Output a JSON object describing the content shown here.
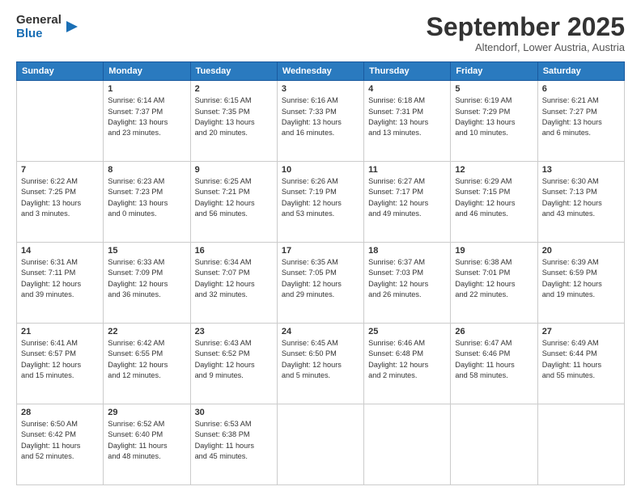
{
  "logo": {
    "line1": "General",
    "line2": "Blue"
  },
  "header": {
    "month": "September 2025",
    "location": "Altendorf, Lower Austria, Austria"
  },
  "days_of_week": [
    "Sunday",
    "Monday",
    "Tuesday",
    "Wednesday",
    "Thursday",
    "Friday",
    "Saturday"
  ],
  "weeks": [
    [
      {
        "day": "",
        "info": ""
      },
      {
        "day": "1",
        "info": "Sunrise: 6:14 AM\nSunset: 7:37 PM\nDaylight: 13 hours\nand 23 minutes."
      },
      {
        "day": "2",
        "info": "Sunrise: 6:15 AM\nSunset: 7:35 PM\nDaylight: 13 hours\nand 20 minutes."
      },
      {
        "day": "3",
        "info": "Sunrise: 6:16 AM\nSunset: 7:33 PM\nDaylight: 13 hours\nand 16 minutes."
      },
      {
        "day": "4",
        "info": "Sunrise: 6:18 AM\nSunset: 7:31 PM\nDaylight: 13 hours\nand 13 minutes."
      },
      {
        "day": "5",
        "info": "Sunrise: 6:19 AM\nSunset: 7:29 PM\nDaylight: 13 hours\nand 10 minutes."
      },
      {
        "day": "6",
        "info": "Sunrise: 6:21 AM\nSunset: 7:27 PM\nDaylight: 13 hours\nand 6 minutes."
      }
    ],
    [
      {
        "day": "7",
        "info": "Sunrise: 6:22 AM\nSunset: 7:25 PM\nDaylight: 13 hours\nand 3 minutes."
      },
      {
        "day": "8",
        "info": "Sunrise: 6:23 AM\nSunset: 7:23 PM\nDaylight: 13 hours\nand 0 minutes."
      },
      {
        "day": "9",
        "info": "Sunrise: 6:25 AM\nSunset: 7:21 PM\nDaylight: 12 hours\nand 56 minutes."
      },
      {
        "day": "10",
        "info": "Sunrise: 6:26 AM\nSunset: 7:19 PM\nDaylight: 12 hours\nand 53 minutes."
      },
      {
        "day": "11",
        "info": "Sunrise: 6:27 AM\nSunset: 7:17 PM\nDaylight: 12 hours\nand 49 minutes."
      },
      {
        "day": "12",
        "info": "Sunrise: 6:29 AM\nSunset: 7:15 PM\nDaylight: 12 hours\nand 46 minutes."
      },
      {
        "day": "13",
        "info": "Sunrise: 6:30 AM\nSunset: 7:13 PM\nDaylight: 12 hours\nand 43 minutes."
      }
    ],
    [
      {
        "day": "14",
        "info": "Sunrise: 6:31 AM\nSunset: 7:11 PM\nDaylight: 12 hours\nand 39 minutes."
      },
      {
        "day": "15",
        "info": "Sunrise: 6:33 AM\nSunset: 7:09 PM\nDaylight: 12 hours\nand 36 minutes."
      },
      {
        "day": "16",
        "info": "Sunrise: 6:34 AM\nSunset: 7:07 PM\nDaylight: 12 hours\nand 32 minutes."
      },
      {
        "day": "17",
        "info": "Sunrise: 6:35 AM\nSunset: 7:05 PM\nDaylight: 12 hours\nand 29 minutes."
      },
      {
        "day": "18",
        "info": "Sunrise: 6:37 AM\nSunset: 7:03 PM\nDaylight: 12 hours\nand 26 minutes."
      },
      {
        "day": "19",
        "info": "Sunrise: 6:38 AM\nSunset: 7:01 PM\nDaylight: 12 hours\nand 22 minutes."
      },
      {
        "day": "20",
        "info": "Sunrise: 6:39 AM\nSunset: 6:59 PM\nDaylight: 12 hours\nand 19 minutes."
      }
    ],
    [
      {
        "day": "21",
        "info": "Sunrise: 6:41 AM\nSunset: 6:57 PM\nDaylight: 12 hours\nand 15 minutes."
      },
      {
        "day": "22",
        "info": "Sunrise: 6:42 AM\nSunset: 6:55 PM\nDaylight: 12 hours\nand 12 minutes."
      },
      {
        "day": "23",
        "info": "Sunrise: 6:43 AM\nSunset: 6:52 PM\nDaylight: 12 hours\nand 9 minutes."
      },
      {
        "day": "24",
        "info": "Sunrise: 6:45 AM\nSunset: 6:50 PM\nDaylight: 12 hours\nand 5 minutes."
      },
      {
        "day": "25",
        "info": "Sunrise: 6:46 AM\nSunset: 6:48 PM\nDaylight: 12 hours\nand 2 minutes."
      },
      {
        "day": "26",
        "info": "Sunrise: 6:47 AM\nSunset: 6:46 PM\nDaylight: 11 hours\nand 58 minutes."
      },
      {
        "day": "27",
        "info": "Sunrise: 6:49 AM\nSunset: 6:44 PM\nDaylight: 11 hours\nand 55 minutes."
      }
    ],
    [
      {
        "day": "28",
        "info": "Sunrise: 6:50 AM\nSunset: 6:42 PM\nDaylight: 11 hours\nand 52 minutes."
      },
      {
        "day": "29",
        "info": "Sunrise: 6:52 AM\nSunset: 6:40 PM\nDaylight: 11 hours\nand 48 minutes."
      },
      {
        "day": "30",
        "info": "Sunrise: 6:53 AM\nSunset: 6:38 PM\nDaylight: 11 hours\nand 45 minutes."
      },
      {
        "day": "",
        "info": ""
      },
      {
        "day": "",
        "info": ""
      },
      {
        "day": "",
        "info": ""
      },
      {
        "day": "",
        "info": ""
      }
    ]
  ]
}
